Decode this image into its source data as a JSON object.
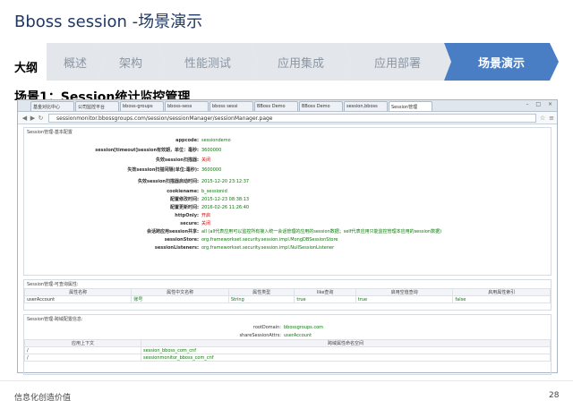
{
  "slide": {
    "title": "Bboss session -场景演示",
    "outline_label": "大纲",
    "steps": [
      "概述",
      "架构",
      "性能测试",
      "应用集成",
      "应用部署",
      "场景演示"
    ],
    "scenario_heading": "场景1：Session统计监控管理",
    "footer_left": "信息化创造价值",
    "page_number": "28",
    "colors": {
      "active_step": "#4a7ec4",
      "inactive_step": "#e3e7ec",
      "title": "#1f3864"
    }
  },
  "browser": {
    "tabs": [
      "基金对比中心",
      "公司监控平台",
      "bboss-groups",
      "bboss-sess",
      "bboss sessi",
      "BBoss Demo",
      "BBoss Demo",
      "session,bboss",
      "Session管理"
    ],
    "active_tab": 8,
    "url": "sessionmonitor.bbossgroups.com/session/sessionManager/sessionManager.page",
    "window_controls": "– □ ×"
  },
  "basic_config": {
    "header": "Session管理-基本配置",
    "rows": [
      {
        "key": "appcode:",
        "value": "sessiondemo",
        "style": "green"
      },
      {
        "key": "session[timeout]session有效期，单位：毫秒:",
        "value": "3600000",
        "style": "green",
        "tall": true
      },
      {
        "key": "失效session扫描器:",
        "value": "关闭",
        "style": "red"
      },
      {
        "key": "失效session扫描间隔(单位:毫秒):",
        "value": "3600000",
        "style": "green",
        "tall": true
      },
      {
        "key": "失效session扫描器启动时间:",
        "value": "2015-12-20 23:12:37",
        "style": "green",
        "tall": true
      },
      {
        "key": "cookiename:",
        "value": "b_sessionid",
        "style": "green"
      },
      {
        "key": "配置修改时间:",
        "value": "2015-12-23 08:38:13",
        "style": "green"
      },
      {
        "key": "配置更新时间:",
        "value": "2016-02-26 11:26:40",
        "style": "green"
      },
      {
        "key": "httpOnly:",
        "value": "开启",
        "style": "red"
      },
      {
        "key": "secure:",
        "value": "关闭",
        "style": "red"
      },
      {
        "key": "会话跨应用session共享:",
        "value": "all  (all代表应用可以监控所有接入统一会话管理的应用的session数据；self代表应用只能监控管理本应用的session数据)",
        "style": "green"
      },
      {
        "key": "sessionStore:",
        "value": "org.frameworkset.security.session.impl.MongDBSessionStore",
        "style": "green"
      },
      {
        "key": "sessionListeners:",
        "value": "org.frameworkset.security.session.impl.NullSessionListener",
        "style": "green"
      }
    ]
  },
  "query_config": {
    "header": "Session管理-可查询属性:",
    "columns": [
      "属性名称",
      "属性中文名称",
      "属性类型",
      "like查询",
      "启用空值查询",
      "启用属性索引"
    ],
    "rows": [
      [
        "userAccount",
        "账号",
        "String",
        "true",
        "true",
        "false"
      ]
    ]
  },
  "cross_config": {
    "header": "Session管理-跨域配置信息:",
    "root_domain_key": "rootDomain:",
    "root_domain_value": "bbossgroups.com",
    "share_attr_key": "shareSessionAttrs:",
    "share_attr_value": "userAccount",
    "columns": [
      "应用上下文",
      "跨域属性命名空间"
    ],
    "rows": [
      [
        "/",
        "session_bboss_com_cnf"
      ],
      [
        "/",
        "sessionmonitor_bboss_com_cnf"
      ]
    ]
  }
}
